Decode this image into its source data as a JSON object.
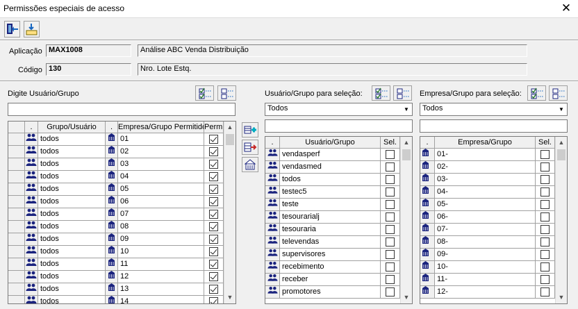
{
  "window": {
    "title": "Permissões especiais de acesso",
    "close_glyph": "✕"
  },
  "toolbar": {
    "buttons": [
      {
        "name": "exit-button",
        "icon": "door-exit-icon"
      },
      {
        "name": "save-button",
        "icon": "save-tray-icon"
      }
    ]
  },
  "info": {
    "aplicacao_label": "Aplicação",
    "aplicacao_code": "MAX1008",
    "aplicacao_desc": "Análise ABC Venda Distribuição",
    "codigo_label": "Código",
    "codigo_value": "130",
    "codigo_desc": "Nro. Lote Estq."
  },
  "left": {
    "label": "Digite Usuário/Grupo",
    "search_value": "",
    "columns": [
      ".",
      "Grupo/Usuário",
      ".",
      "Empresa/Grupo Permitido",
      "Perm."
    ],
    "rows": [
      {
        "user": "todos",
        "empresa": "01",
        "perm": true
      },
      {
        "user": "todos",
        "empresa": "02",
        "perm": true
      },
      {
        "user": "todos",
        "empresa": "03",
        "perm": true
      },
      {
        "user": "todos",
        "empresa": "04",
        "perm": true
      },
      {
        "user": "todos",
        "empresa": "05",
        "perm": true
      },
      {
        "user": "todos",
        "empresa": "06",
        "perm": true
      },
      {
        "user": "todos",
        "empresa": "07",
        "perm": true
      },
      {
        "user": "todos",
        "empresa": "08",
        "perm": true
      },
      {
        "user": "todos",
        "empresa": "09",
        "perm": true
      },
      {
        "user": "todos",
        "empresa": "10",
        "perm": true
      },
      {
        "user": "todos",
        "empresa": "11",
        "perm": true
      },
      {
        "user": "todos",
        "empresa": "12",
        "perm": true
      },
      {
        "user": "todos",
        "empresa": "13",
        "perm": true
      },
      {
        "user": "todos",
        "empresa": "14",
        "perm": true
      }
    ]
  },
  "middle": {
    "label": "Usuário/Grupo para seleção:",
    "combo_value": "Todos",
    "search_value": "",
    "columns": [
      ".",
      "Usuário/Grupo",
      "Sel."
    ],
    "rows": [
      {
        "name": "vendasperf",
        "sel": false
      },
      {
        "name": "vendasmed",
        "sel": false
      },
      {
        "name": "todos",
        "sel": false
      },
      {
        "name": "testec5",
        "sel": false
      },
      {
        "name": "teste",
        "sel": false
      },
      {
        "name": "tesourarialj",
        "sel": false
      },
      {
        "name": "tesouraria",
        "sel": false
      },
      {
        "name": "televendas",
        "sel": false
      },
      {
        "name": "supervisores",
        "sel": false
      },
      {
        "name": "recebimento",
        "sel": false
      },
      {
        "name": "receber",
        "sel": false
      },
      {
        "name": "promotores",
        "sel": false
      }
    ]
  },
  "right": {
    "label": "Empresa/Grupo para seleção:",
    "combo_value": "Todos",
    "search_value": "",
    "columns": [
      ".",
      "Empresa/Grupo",
      "Sel."
    ],
    "rows": [
      {
        "name": "01-",
        "sel": false
      },
      {
        "name": "02-",
        "sel": false
      },
      {
        "name": "03-",
        "sel": false
      },
      {
        "name": "04-",
        "sel": false
      },
      {
        "name": "05-",
        "sel": false
      },
      {
        "name": "06-",
        "sel": false
      },
      {
        "name": "07-",
        "sel": false
      },
      {
        "name": "08-",
        "sel": false
      },
      {
        "name": "09-",
        "sel": false
      },
      {
        "name": "10-",
        "sel": false
      },
      {
        "name": "11-",
        "sel": false
      },
      {
        "name": "12-",
        "sel": false
      }
    ]
  },
  "colors": {
    "icon_blue": "#1a237e",
    "check_green": "#2e7d32",
    "dash_blue": "#1565c0"
  }
}
